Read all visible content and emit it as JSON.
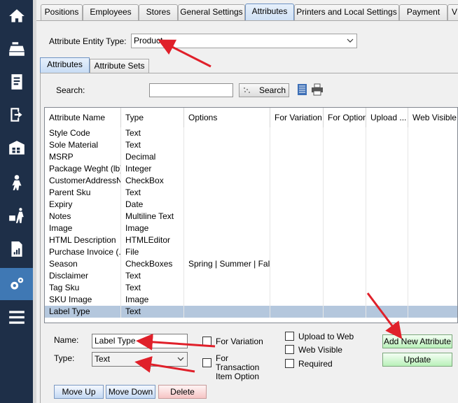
{
  "nav": {
    "items": [
      {
        "icon": "home-icon"
      },
      {
        "icon": "cash-register-icon"
      },
      {
        "icon": "receipt-icon"
      },
      {
        "icon": "exit-icon"
      },
      {
        "icon": "warehouse-icon"
      },
      {
        "icon": "customer-icon"
      },
      {
        "icon": "delivery-icon"
      },
      {
        "icon": "report-icon"
      },
      {
        "icon": "settings-gears-icon",
        "active": true
      },
      {
        "icon": "menu-icon"
      }
    ]
  },
  "top_tabs": [
    "Positions",
    "Employees",
    "Stores",
    "General Settings",
    "Attributes",
    "Printers and Local Settings",
    "Payment",
    "V"
  ],
  "active_top_tab": "Attributes",
  "entity": {
    "label": "Attribute Entity Type:",
    "value": "Product"
  },
  "sub_tabs": [
    "Attributes",
    "Attribute Sets"
  ],
  "search": {
    "label": "Search:",
    "value": "",
    "button_label": "Search"
  },
  "grid": {
    "columns": [
      "Attribute Name",
      "Type",
      "Options",
      "For Variation",
      "For Option",
      "Upload ...",
      "Web Visible"
    ],
    "rows": [
      [
        "Style Code",
        "Text",
        ""
      ],
      [
        "Sole Material",
        "Text",
        ""
      ],
      [
        "MSRP",
        "Decimal",
        ""
      ],
      [
        "Package Weght (lb)",
        "Integer",
        ""
      ],
      [
        "CustomerAddressN...",
        "CheckBox",
        ""
      ],
      [
        "Parent Sku",
        "Text",
        ""
      ],
      [
        "Expiry",
        "Date",
        ""
      ],
      [
        "Notes",
        "Multiline Text",
        ""
      ],
      [
        "Image",
        "Image",
        ""
      ],
      [
        "HTML Description",
        "HTMLEditor",
        ""
      ],
      [
        "Purchase Invoice (...",
        "File",
        ""
      ],
      [
        "Season",
        "CheckBoxes",
        "Spring | Summer | Fall..."
      ],
      [
        "Disclaimer",
        "Text",
        ""
      ],
      [
        "Tag Sku",
        "Text",
        ""
      ],
      [
        "SKU Image",
        "Image",
        ""
      ],
      [
        "Label Type",
        "Text",
        ""
      ]
    ],
    "selected_row": 15
  },
  "form": {
    "name_label": "Name:",
    "name_value": "Label Type",
    "type_label": "Type:",
    "type_value": "Text",
    "for_variation": "For Variation",
    "for_transaction": "For Transaction Item Option",
    "upload_to_web": "Upload to Web",
    "web_visible": "Web Visible",
    "required": "Required",
    "add_button": "Add New Attribute",
    "update_button": "Update",
    "move_up": "Move Up",
    "move_down": "Move Down",
    "delete": "Delete"
  },
  "colors": {
    "rail": "#1e2f48",
    "rail_active": "#3f78b4",
    "annotation_arrow": "#e0202a",
    "selected_row": "#b4c7dd"
  }
}
